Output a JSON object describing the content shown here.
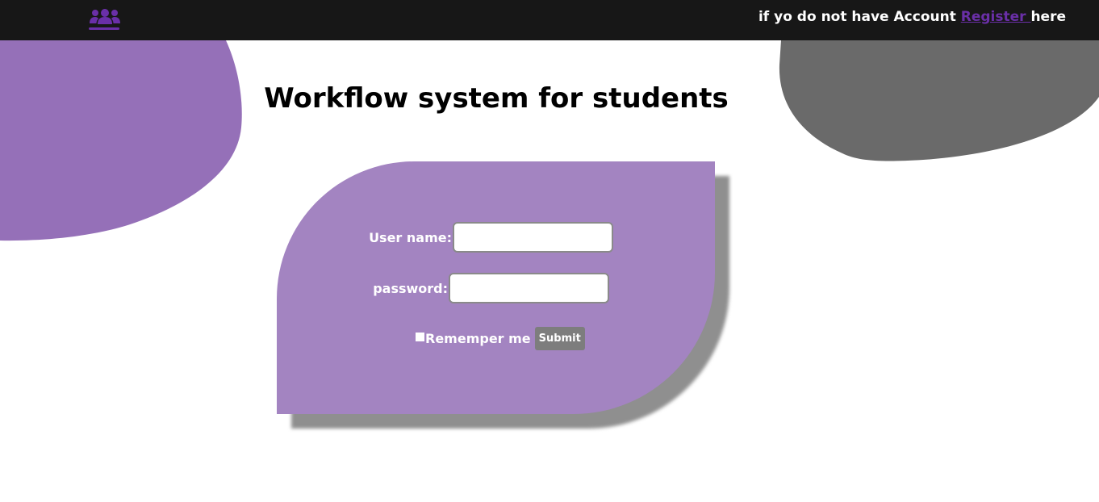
{
  "header": {
    "logo_icon": "users-icon",
    "logo_color": "#6a2fa8",
    "account_prompt_prefix": "if yo do not have Account ",
    "register_link": "Register ",
    "account_prompt_suffix": "here"
  },
  "main": {
    "title": "Workflow system for students"
  },
  "login_form": {
    "username_label": "User name:",
    "username_value": "",
    "password_label": "password:",
    "password_value": "",
    "remember_label": "Rememper me",
    "remember_checked": false,
    "submit_label": "Submit"
  },
  "colors": {
    "topbar": "#171717",
    "card": "#a384c1",
    "blob_purple": "#9570b8",
    "blob_gray": "#6a6a6a",
    "button": "#7d7d7d"
  }
}
